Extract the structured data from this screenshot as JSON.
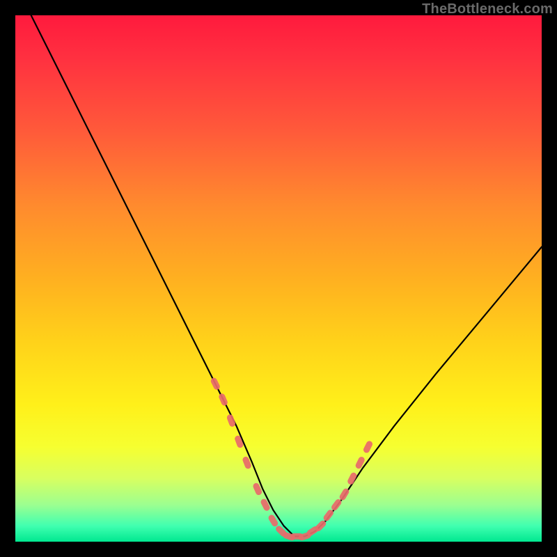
{
  "watermark": "TheBottleneck.com",
  "chart_data": {
    "type": "line",
    "title": "",
    "xlabel": "",
    "ylabel": "",
    "xlim": [
      0,
      100
    ],
    "ylim": [
      0,
      100
    ],
    "grid": false,
    "legend": false,
    "annotations": [],
    "series": [
      {
        "name": "curve",
        "stroke": "#000000",
        "x": [
          3,
          6,
          10,
          14,
          18,
          22,
          26,
          30,
          34,
          38,
          42,
          45,
          47,
          49,
          51,
          53,
          55,
          57,
          59,
          62,
          66,
          72,
          80,
          90,
          100
        ],
        "y": [
          100,
          94,
          86,
          78,
          70,
          62,
          54,
          46,
          38,
          30,
          22,
          15,
          10,
          6,
          3,
          1,
          1,
          2,
          4,
          8,
          14,
          22,
          32,
          44,
          56
        ]
      },
      {
        "name": "optimal-markers",
        "stroke": "#e86a6a",
        "marker": "round",
        "x": [
          38,
          39.5,
          41,
          42.5,
          44,
          46,
          47.5,
          49,
          50.5,
          52,
          53.5,
          55,
          56.5,
          58,
          59.5,
          61,
          62.5,
          64,
          65.5,
          67
        ],
        "y": [
          30,
          27,
          23,
          19,
          15,
          10,
          7,
          4,
          2,
          1,
          1,
          1,
          2,
          3,
          5,
          7,
          9,
          12,
          15,
          18
        ]
      }
    ],
    "background_gradient": {
      "type": "vertical",
      "stops": [
        {
          "pos": 0.0,
          "color": "#ff1a3d"
        },
        {
          "pos": 0.5,
          "color": "#ffb020"
        },
        {
          "pos": 0.82,
          "color": "#f6ff30"
        },
        {
          "pos": 1.0,
          "color": "#00e890"
        }
      ]
    }
  }
}
